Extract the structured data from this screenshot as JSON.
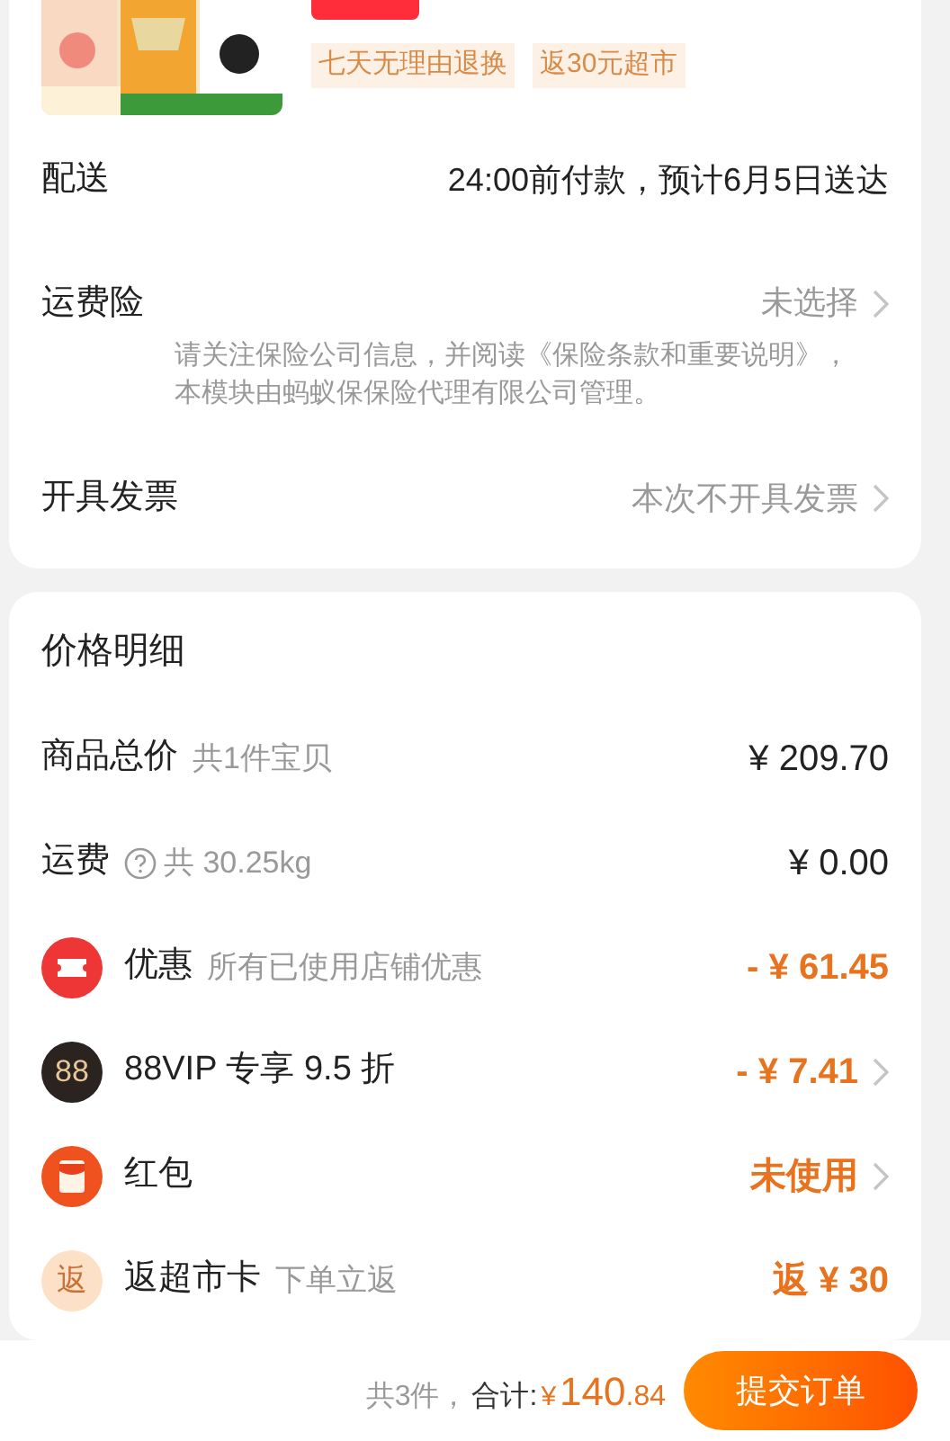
{
  "product": {
    "image": {
      "kind": "picture"
    },
    "tags": [
      "七天无理由退换",
      "返30元超市"
    ]
  },
  "options": [
    {
      "kind": "info",
      "label": "配送",
      "value": "24:00前付款，预计6月5日送达"
    },
    {
      "kind": "link",
      "label": "运费险",
      "value": "未选择",
      "note": "请关注保险公司信息，并阅读《保险条款和重要说明》，本模块由蚂蚁保保险代理有限公司管理。"
    },
    {
      "kind": "link",
      "label": "开具发票",
      "value": "本次不开具发票"
    }
  ],
  "price_details": {
    "title": "价格明细",
    "rows": [
      {
        "kind": "total",
        "label": "商品总价",
        "sub": "共1件宝贝",
        "value": "¥ 209.70"
      },
      {
        "kind": "shipping",
        "label": "运费",
        "sub": "共 30.25kg",
        "value": "¥ 0.00"
      },
      {
        "kind": "coupon",
        "label": "优惠",
        "sub": "所有已使用店铺优惠",
        "value": "- ¥ 61.45"
      },
      {
        "kind": "vip",
        "badge": "88",
        "label": "88VIP 专享 9.5 折",
        "value": "- ¥ 7.41"
      },
      {
        "kind": "red_packet",
        "label": "红包",
        "value": "未使用"
      },
      {
        "kind": "rebate",
        "badge": "返",
        "label": "返超市卡",
        "sub": "下单立返",
        "value": "返 ¥ 30"
      }
    ]
  },
  "footer": {
    "count": "共3件，",
    "total_label": "合计:",
    "currency": "¥",
    "amount_int": "140",
    "amount_dec": ".84",
    "button": "提交订单"
  }
}
